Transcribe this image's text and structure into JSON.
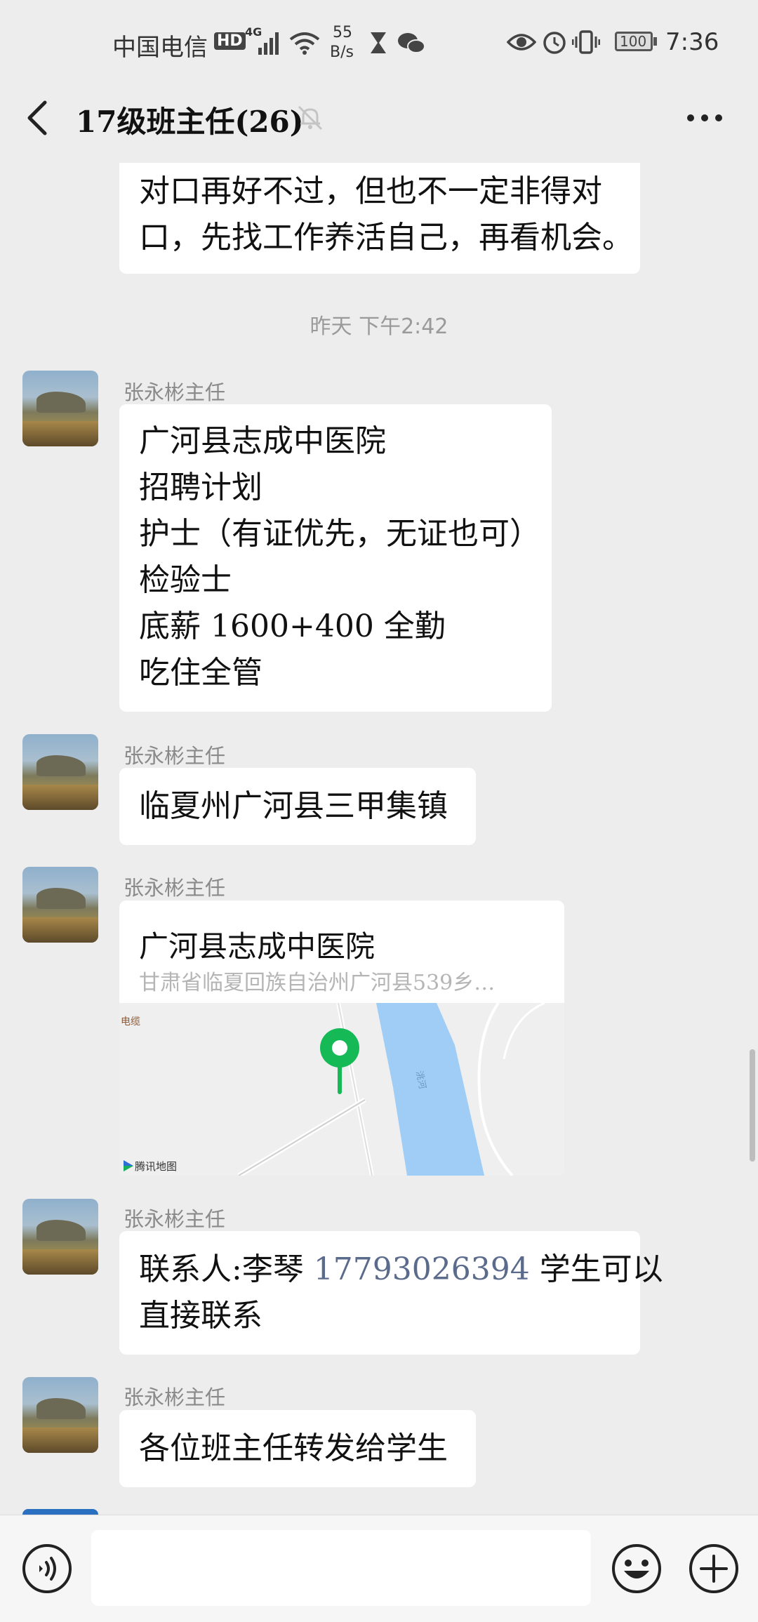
{
  "status_bar": {
    "carrier": "中国电信",
    "hd": "HD",
    "network": "4G",
    "speed_value": "55",
    "speed_unit": "B/s",
    "battery": "100",
    "time": "7:36"
  },
  "header": {
    "title": "17级班主任(26)",
    "back_icon": "back-arrow-icon",
    "mute_icon": "bell-muted-icon",
    "more_icon": "more-dots-icon"
  },
  "chat": {
    "prev_message_lines": [
      "对口再好不过，但也不一定非得对",
      "口，先找工作养活自己，再看机会。"
    ],
    "timestamp": "昨天 下午2:42",
    "messages": [
      {
        "sender": "张永彬主任",
        "lines": [
          "广河县志成中医院",
          "招聘计划",
          "护士（有证优先，无证也可）",
          "检验士",
          "底薪 1600+400 全勤",
          "吃住全管"
        ]
      },
      {
        "sender": "张永彬主任",
        "lines": [
          "临夏州广河县三甲集镇"
        ]
      },
      {
        "sender": "张永彬主任",
        "location": {
          "name": "广河县志成中医院",
          "address": "甘肃省临夏回族自治州广河县539乡…",
          "map_label": "电缆",
          "river_label": "洮河",
          "provider": "腾讯地图"
        }
      },
      {
        "sender": "张永彬主任",
        "contact": {
          "prefix": "联系人:李琴 ",
          "phone": "17793026394",
          "suffix": " 学生可以",
          "line2": "直接联系"
        }
      },
      {
        "sender": "张永彬主任",
        "lines": [
          "各位班主任转发给学生"
        ]
      }
    ]
  },
  "input_bar": {
    "voice_icon": "voice-icon",
    "emoji_icon": "emoji-icon",
    "plus_icon": "plus-icon"
  }
}
